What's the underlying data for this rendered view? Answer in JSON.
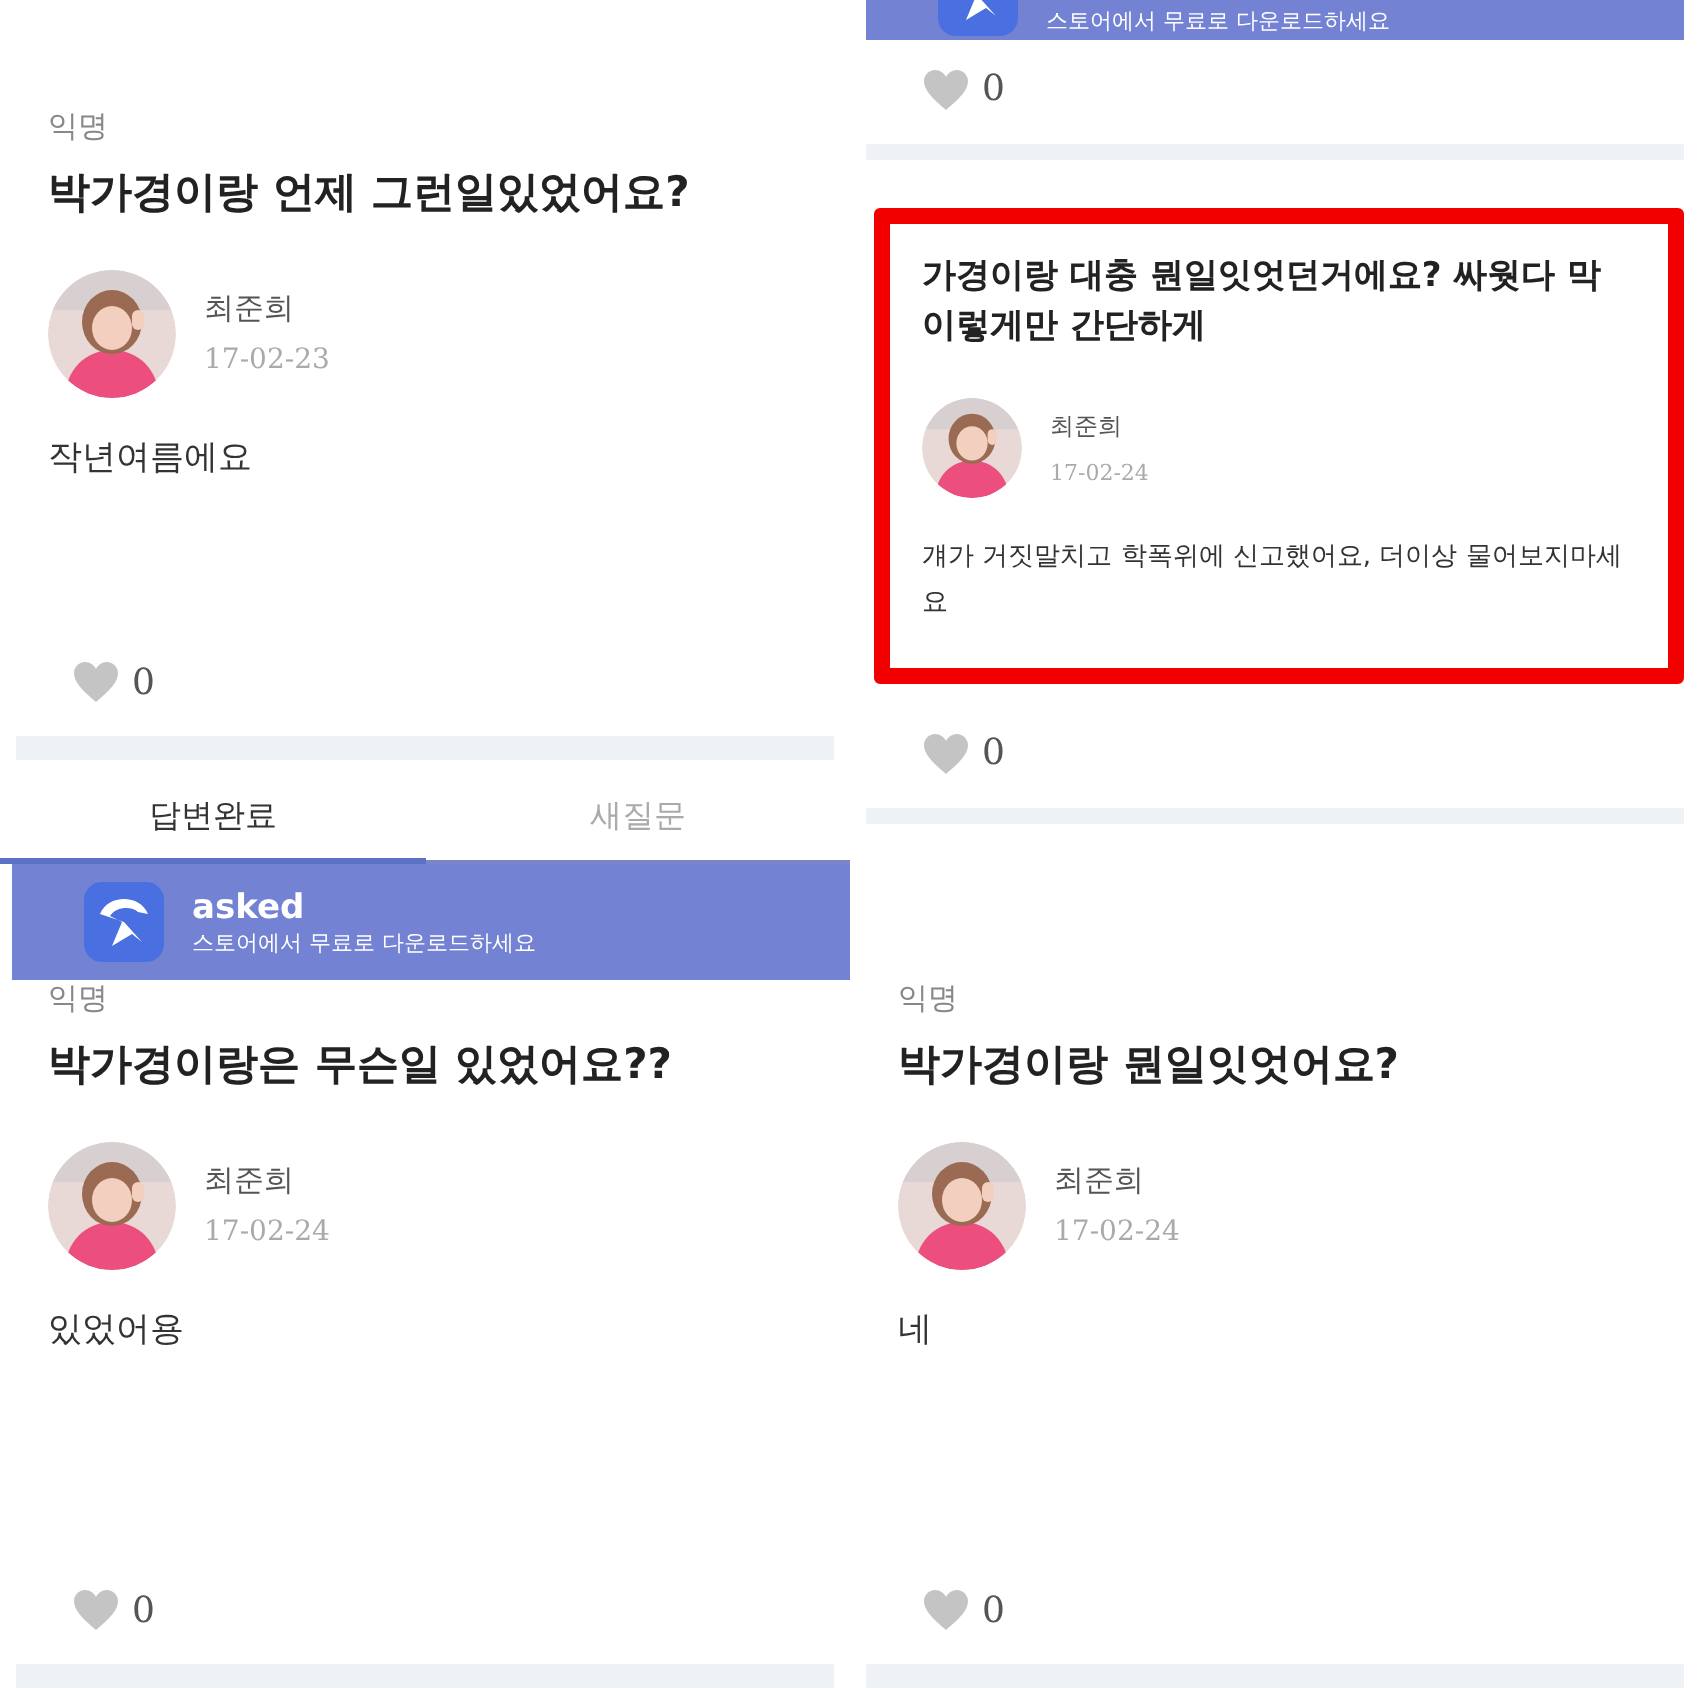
{
  "columns": [
    [
      {
        "blocks": [
          {
            "kind": "post",
            "label": "익명",
            "question": "박가경이랑 언제 그런일있었어요?",
            "name": "최준희",
            "date": "17-02-23",
            "answer": "작년여름에요",
            "likes": "0",
            "highlighted": false
          }
        ]
      },
      {
        "blocks": [
          {
            "kind": "tabs",
            "tabs": [
              {
                "label": "답변완료",
                "selected": true
              },
              {
                "label": "새질문",
                "selected": false
              }
            ]
          },
          {
            "kind": "banner",
            "title": "asked",
            "subtitle": "스토어에서 무료로 다운로드하세요"
          },
          {
            "kind": "post",
            "label": "익명",
            "question": "박가경이랑은 무슨일 있었어요??",
            "name": "최준희",
            "date": "17-02-24",
            "answer": "있었어용",
            "likes": "0",
            "highlighted": false
          }
        ]
      }
    ],
    [
      {
        "blocks": [
          {
            "kind": "banner",
            "subtitle": "스토어에서 무료로 다운로드하세요"
          },
          {
            "kind": "likes",
            "likes": "0"
          },
          {
            "kind": "post",
            "question": "가경이랑 대충 뭔일잇엇던거에요? 싸웟다 막 이렇게만 간단하게",
            "name": "최준희",
            "date": "17-02-24",
            "answer": "걔가 거짓말치고 학폭위에 신고했어요, 더이상 물어보지마세요",
            "likes": "0",
            "highlighted": true
          }
        ]
      },
      {
        "blocks": [
          {
            "kind": "post",
            "label": "익명",
            "question": "박가경이랑 뭔일잇엇어요?",
            "name": "최준희",
            "date": "17-02-24",
            "answer": "네",
            "likes": "0",
            "highlighted": false
          }
        ]
      }
    ]
  ]
}
